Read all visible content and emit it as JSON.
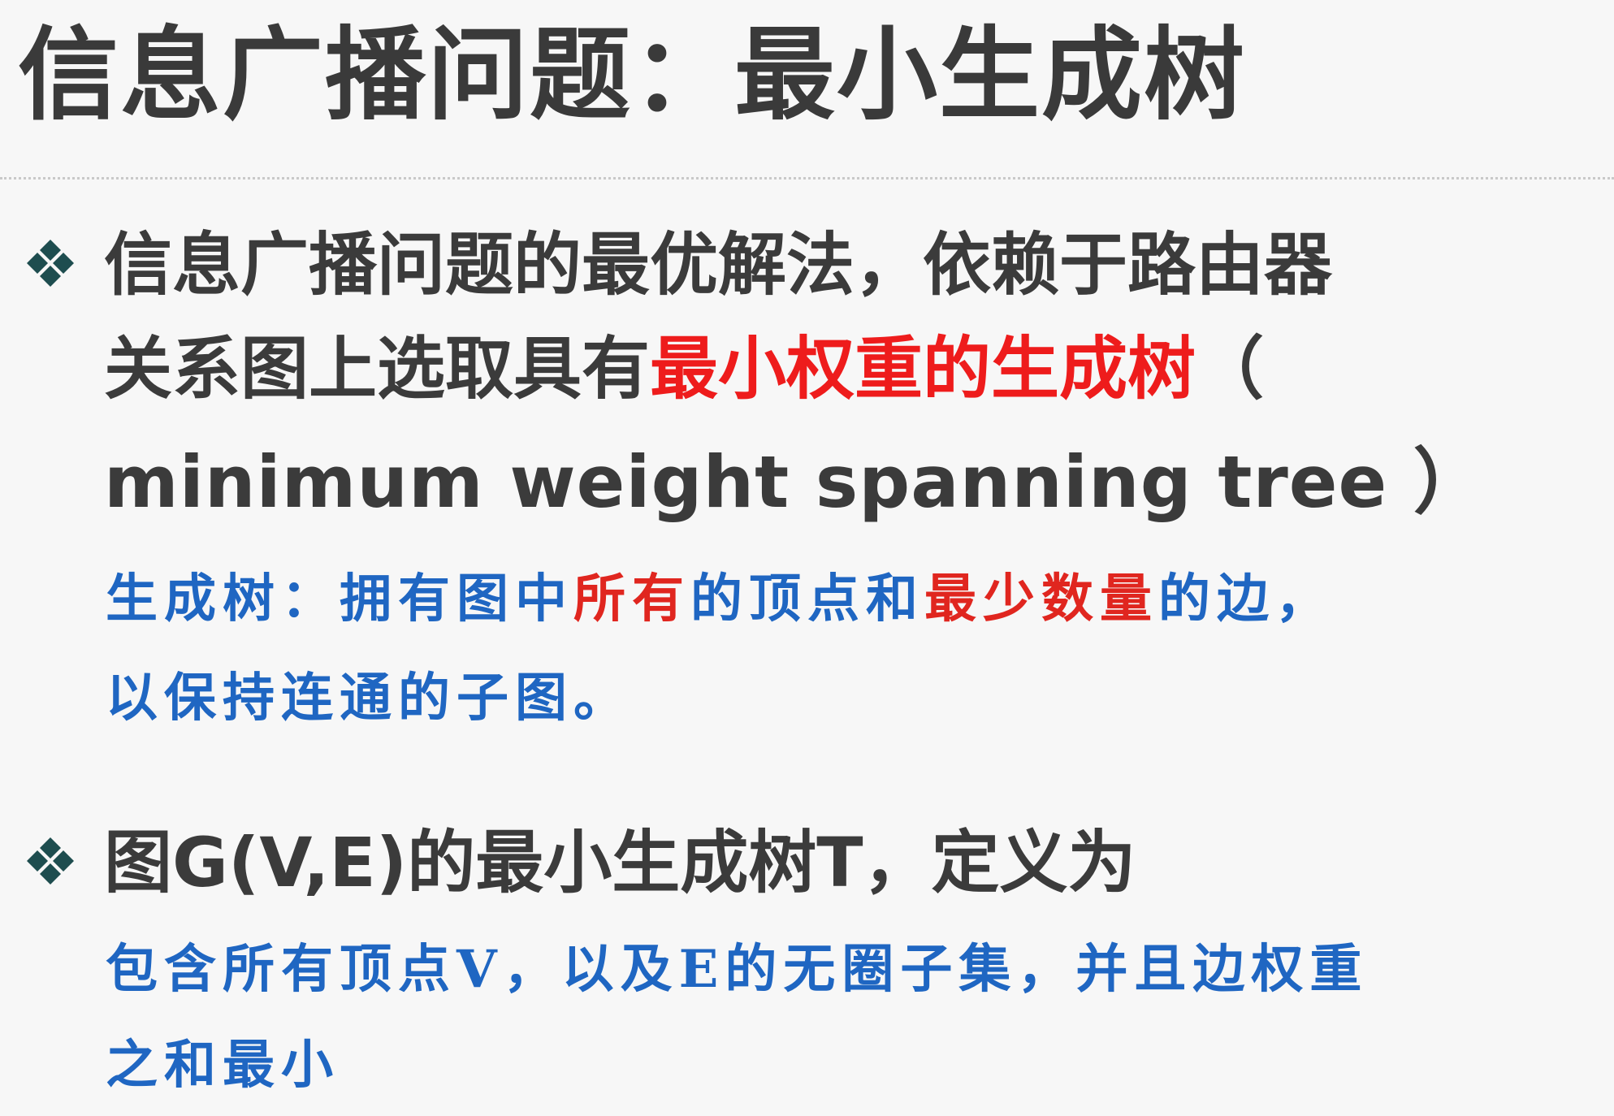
{
  "slide": {
    "title": "信息广播问题：最小生成树",
    "colors": {
      "text": "#3b3b3b",
      "highlight": "#ee1c1c",
      "note": "#1f66c2",
      "note_highlight": "#e0261f",
      "bullet": "#1e4d4f"
    },
    "bullet_icon": "diamond-bullet-icon",
    "point1": {
      "line1": "信息广播问题的最优解法，依赖于路由器",
      "line2_pre": "关系图上选取具有",
      "line2_highlight": "最小权重的生成树",
      "line2_post": "（",
      "line3": "minimum weight spanning tree ）"
    },
    "note1": {
      "line1_a": "生成树：拥有图中",
      "line1_b": "所有",
      "line1_c": "的顶点和",
      "line1_d": "最少数量",
      "line1_e": "的边，",
      "line2": "以保持连通的子图。"
    },
    "point2": {
      "line1": "图G(V,E)的最小生成树T，定义为"
    },
    "note2": {
      "line1": "包含所有顶点V，以及E的无圈子集，并且边权重",
      "line2": "之和最小"
    }
  }
}
